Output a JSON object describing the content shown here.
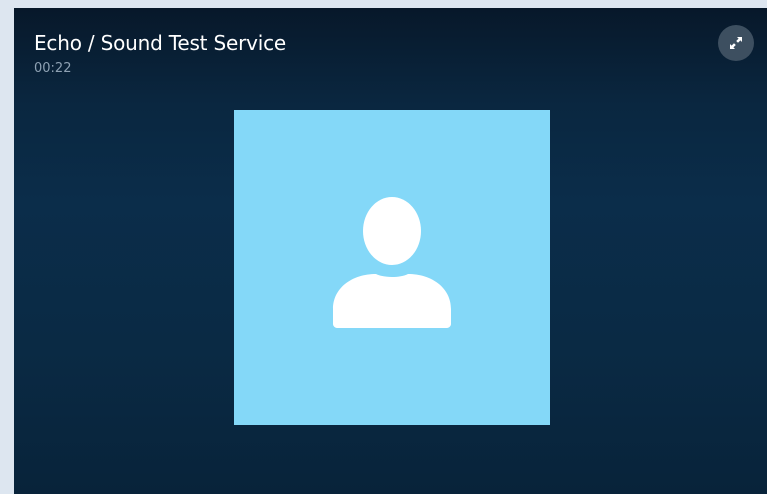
{
  "call": {
    "title": "Echo / Sound Test Service",
    "duration": "00:22"
  },
  "controls": {
    "expand_icon": "expand-arrows-icon"
  },
  "avatar": {
    "icon": "person-silhouette-icon",
    "tile_color": "#84d8f8"
  },
  "colors": {
    "window_background": "#0b2d4a",
    "title_text": "#ffffff",
    "duration_text": "#8ea1b3",
    "expand_button_bg": "#3d4f60"
  }
}
